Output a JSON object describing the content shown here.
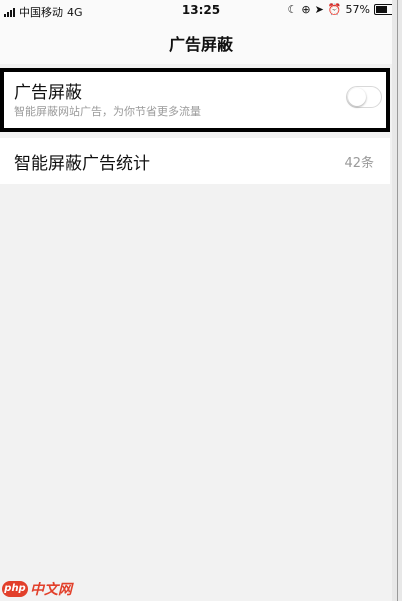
{
  "status_bar": {
    "carrier": "中国移动",
    "network": "4G",
    "time": "13:25",
    "battery": "57%",
    "battery_level": 0.57,
    "icons": [
      "moon-icon",
      "lock-rotation-icon",
      "location-icon",
      "alarm-icon"
    ]
  },
  "nav": {
    "title": "广告屏蔽"
  },
  "adblock": {
    "title": "广告屏蔽",
    "description": "智能屏蔽网站广告，为你节省更多流量",
    "enabled": false
  },
  "stats": {
    "label": "智能屏蔽广告统计",
    "count": "42条"
  },
  "watermark": {
    "logo": "php",
    "text": "中文网"
  },
  "colors": {
    "background": "#f2f2f2",
    "card": "#ffffff",
    "secondary_text": "#9a9a9a",
    "watermark": "#e2402b"
  }
}
